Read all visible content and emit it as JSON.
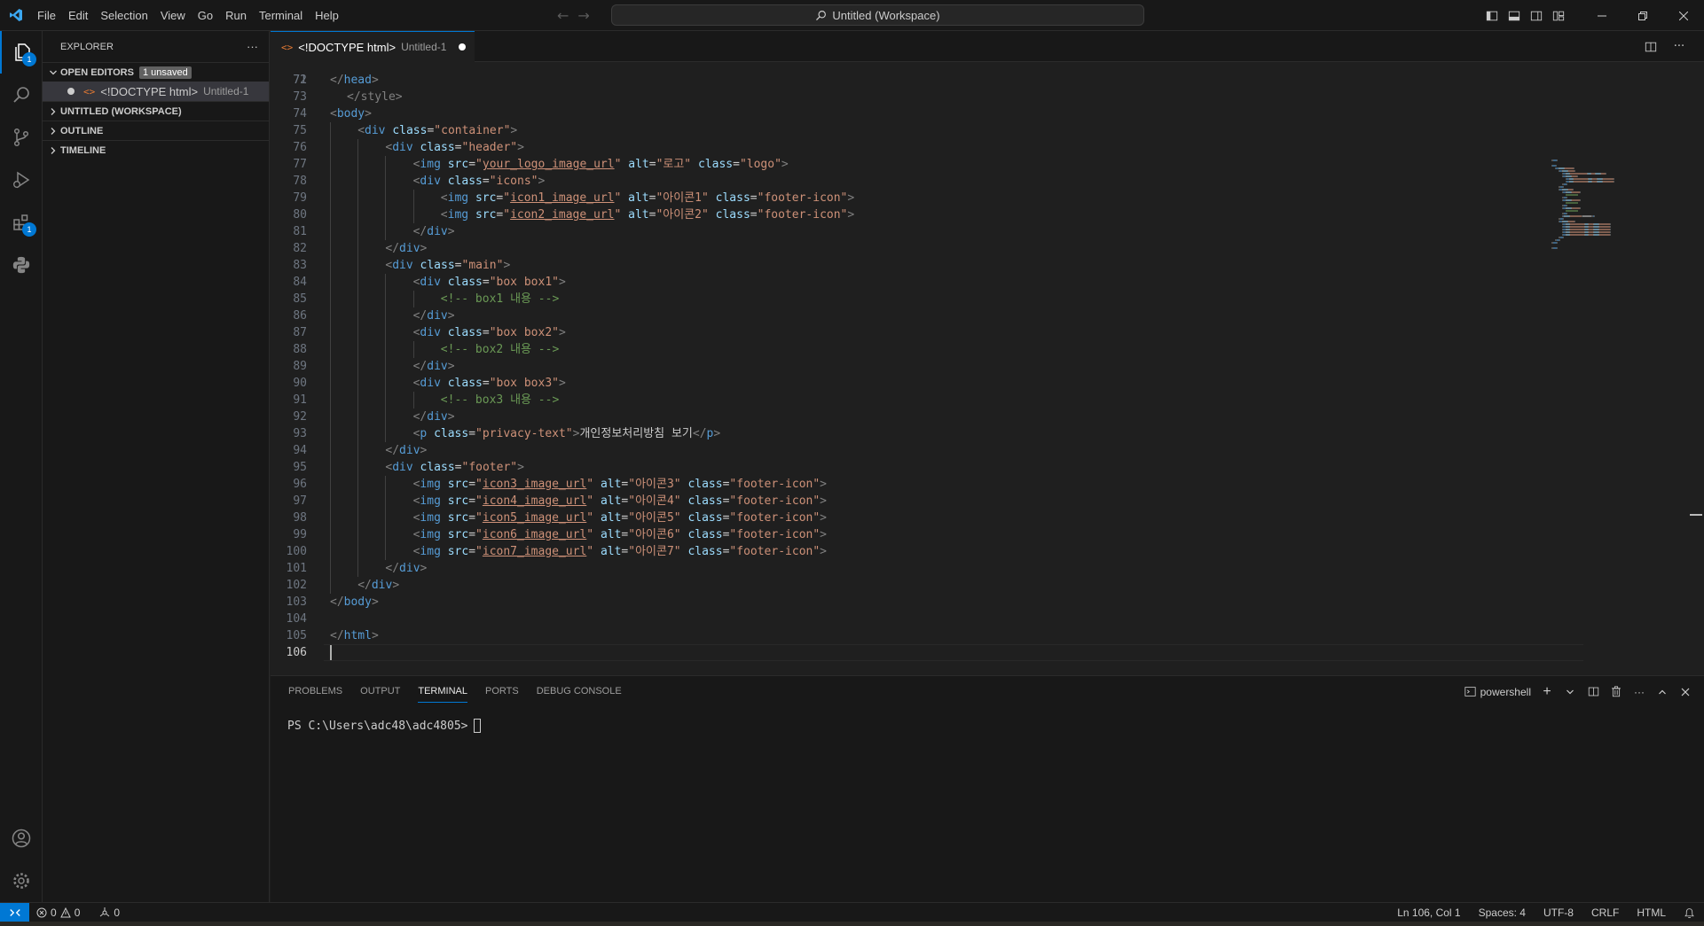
{
  "titlebar": {
    "menu": [
      "File",
      "Edit",
      "Selection",
      "View",
      "Go",
      "Run",
      "Terminal",
      "Help"
    ],
    "search_text": "Untitled (Workspace)"
  },
  "activitybar": {
    "explorer_badge": "1",
    "extensions_badge": "1"
  },
  "sidebar": {
    "title": "EXPLORER",
    "more": "···",
    "open_editors": "OPEN EDITORS",
    "unsaved_badge": "1 unsaved",
    "open_file_name": "<!DOCTYPE html>",
    "open_file_desc": "Untitled-1",
    "sections": [
      "UNTITLED (WORKSPACE)",
      "OUTLINE",
      "TIMELINE"
    ]
  },
  "editor": {
    "tab_name": "<!DOCTYPE html>",
    "tab_desc": "Untitled-1",
    "top_partial": "</style>",
    "lines": [
      {
        "n": "72",
        "indent": 0,
        "parts": [
          [
            "brk",
            "</"
          ],
          [
            "tag",
            "head"
          ],
          [
            "brk",
            ">"
          ]
        ]
      },
      {
        "n": "73",
        "indent": 0,
        "parts": []
      },
      {
        "n": "74",
        "indent": 0,
        "parts": [
          [
            "brk",
            "<"
          ],
          [
            "tag",
            "body"
          ],
          [
            "brk",
            ">"
          ]
        ]
      },
      {
        "n": "75",
        "indent": 1,
        "parts": [
          [
            "brk",
            "<"
          ],
          [
            "tag",
            "div"
          ],
          [
            "txt",
            " "
          ],
          [
            "attr",
            "class"
          ],
          [
            "txt",
            "="
          ],
          [
            "str",
            "\"container\""
          ],
          [
            "brk",
            ">"
          ]
        ]
      },
      {
        "n": "76",
        "indent": 2,
        "parts": [
          [
            "brk",
            "<"
          ],
          [
            "tag",
            "div"
          ],
          [
            "txt",
            " "
          ],
          [
            "attr",
            "class"
          ],
          [
            "txt",
            "="
          ],
          [
            "str",
            "\"header\""
          ],
          [
            "brk",
            ">"
          ]
        ]
      },
      {
        "n": "77",
        "indent": 3,
        "parts": [
          [
            "brk",
            "<"
          ],
          [
            "tag",
            "img"
          ],
          [
            "txt",
            " "
          ],
          [
            "attr",
            "src"
          ],
          [
            "txt",
            "="
          ],
          [
            "str",
            "\""
          ],
          [
            "url",
            "your_logo_image_url"
          ],
          [
            "str",
            "\""
          ],
          [
            "txt",
            " "
          ],
          [
            "attr",
            "alt"
          ],
          [
            "txt",
            "="
          ],
          [
            "str",
            "\"로고\""
          ],
          [
            "txt",
            " "
          ],
          [
            "attr",
            "class"
          ],
          [
            "txt",
            "="
          ],
          [
            "str",
            "\"logo\""
          ],
          [
            "brk",
            ">"
          ]
        ]
      },
      {
        "n": "78",
        "indent": 3,
        "parts": [
          [
            "brk",
            "<"
          ],
          [
            "tag",
            "div"
          ],
          [
            "txt",
            " "
          ],
          [
            "attr",
            "class"
          ],
          [
            "txt",
            "="
          ],
          [
            "str",
            "\"icons\""
          ],
          [
            "brk",
            ">"
          ]
        ]
      },
      {
        "n": "79",
        "indent": 4,
        "parts": [
          [
            "brk",
            "<"
          ],
          [
            "tag",
            "img"
          ],
          [
            "txt",
            " "
          ],
          [
            "attr",
            "src"
          ],
          [
            "txt",
            "="
          ],
          [
            "str",
            "\""
          ],
          [
            "url",
            "icon1_image_url"
          ],
          [
            "str",
            "\""
          ],
          [
            "txt",
            " "
          ],
          [
            "attr",
            "alt"
          ],
          [
            "txt",
            "="
          ],
          [
            "str",
            "\"아이콘1\""
          ],
          [
            "txt",
            " "
          ],
          [
            "attr",
            "class"
          ],
          [
            "txt",
            "="
          ],
          [
            "str",
            "\"footer-icon\""
          ],
          [
            "brk",
            ">"
          ]
        ]
      },
      {
        "n": "80",
        "indent": 4,
        "parts": [
          [
            "brk",
            "<"
          ],
          [
            "tag",
            "img"
          ],
          [
            "txt",
            " "
          ],
          [
            "attr",
            "src"
          ],
          [
            "txt",
            "="
          ],
          [
            "str",
            "\""
          ],
          [
            "url",
            "icon2_image_url"
          ],
          [
            "str",
            "\""
          ],
          [
            "txt",
            " "
          ],
          [
            "attr",
            "alt"
          ],
          [
            "txt",
            "="
          ],
          [
            "str",
            "\"아이콘2\""
          ],
          [
            "txt",
            " "
          ],
          [
            "attr",
            "class"
          ],
          [
            "txt",
            "="
          ],
          [
            "str",
            "\"footer-icon\""
          ],
          [
            "brk",
            ">"
          ]
        ]
      },
      {
        "n": "81",
        "indent": 3,
        "parts": [
          [
            "brk",
            "</"
          ],
          [
            "tag",
            "div"
          ],
          [
            "brk",
            ">"
          ]
        ]
      },
      {
        "n": "82",
        "indent": 2,
        "parts": [
          [
            "brk",
            "</"
          ],
          [
            "tag",
            "div"
          ],
          [
            "brk",
            ">"
          ]
        ]
      },
      {
        "n": "83",
        "indent": 2,
        "parts": [
          [
            "brk",
            "<"
          ],
          [
            "tag",
            "div"
          ],
          [
            "txt",
            " "
          ],
          [
            "attr",
            "class"
          ],
          [
            "txt",
            "="
          ],
          [
            "str",
            "\"main\""
          ],
          [
            "brk",
            ">"
          ]
        ]
      },
      {
        "n": "84",
        "indent": 3,
        "parts": [
          [
            "brk",
            "<"
          ],
          [
            "tag",
            "div"
          ],
          [
            "txt",
            " "
          ],
          [
            "attr",
            "class"
          ],
          [
            "txt",
            "="
          ],
          [
            "str",
            "\"box box1\""
          ],
          [
            "brk",
            ">"
          ]
        ]
      },
      {
        "n": "85",
        "indent": 4,
        "parts": [
          [
            "cmt",
            "<!-- box1 내용 -->"
          ]
        ]
      },
      {
        "n": "86",
        "indent": 3,
        "parts": [
          [
            "brk",
            "</"
          ],
          [
            "tag",
            "div"
          ],
          [
            "brk",
            ">"
          ]
        ]
      },
      {
        "n": "87",
        "indent": 3,
        "parts": [
          [
            "brk",
            "<"
          ],
          [
            "tag",
            "div"
          ],
          [
            "txt",
            " "
          ],
          [
            "attr",
            "class"
          ],
          [
            "txt",
            "="
          ],
          [
            "str",
            "\"box box2\""
          ],
          [
            "brk",
            ">"
          ]
        ]
      },
      {
        "n": "88",
        "indent": 4,
        "parts": [
          [
            "cmt",
            "<!-- box2 내용 -->"
          ]
        ]
      },
      {
        "n": "89",
        "indent": 3,
        "parts": [
          [
            "brk",
            "</"
          ],
          [
            "tag",
            "div"
          ],
          [
            "brk",
            ">"
          ]
        ]
      },
      {
        "n": "90",
        "indent": 3,
        "parts": [
          [
            "brk",
            "<"
          ],
          [
            "tag",
            "div"
          ],
          [
            "txt",
            " "
          ],
          [
            "attr",
            "class"
          ],
          [
            "txt",
            "="
          ],
          [
            "str",
            "\"box box3\""
          ],
          [
            "brk",
            ">"
          ]
        ]
      },
      {
        "n": "91",
        "indent": 4,
        "parts": [
          [
            "cmt",
            "<!-- box3 내용 -->"
          ]
        ]
      },
      {
        "n": "92",
        "indent": 3,
        "parts": [
          [
            "brk",
            "</"
          ],
          [
            "tag",
            "div"
          ],
          [
            "brk",
            ">"
          ]
        ]
      },
      {
        "n": "93",
        "indent": 3,
        "parts": [
          [
            "brk",
            "<"
          ],
          [
            "tag",
            "p"
          ],
          [
            "txt",
            " "
          ],
          [
            "attr",
            "class"
          ],
          [
            "txt",
            "="
          ],
          [
            "str",
            "\"privacy-text\""
          ],
          [
            "brk",
            ">"
          ],
          [
            "txt",
            "개인정보처리방침 보기"
          ],
          [
            "brk",
            "</"
          ],
          [
            "tag",
            "p"
          ],
          [
            "brk",
            ">"
          ]
        ]
      },
      {
        "n": "94",
        "indent": 2,
        "parts": [
          [
            "brk",
            "</"
          ],
          [
            "tag",
            "div"
          ],
          [
            "brk",
            ">"
          ]
        ]
      },
      {
        "n": "95",
        "indent": 2,
        "parts": [
          [
            "brk",
            "<"
          ],
          [
            "tag",
            "div"
          ],
          [
            "txt",
            " "
          ],
          [
            "attr",
            "class"
          ],
          [
            "txt",
            "="
          ],
          [
            "str",
            "\"footer\""
          ],
          [
            "brk",
            ">"
          ]
        ]
      },
      {
        "n": "96",
        "indent": 3,
        "parts": [
          [
            "brk",
            "<"
          ],
          [
            "tag",
            "img"
          ],
          [
            "txt",
            " "
          ],
          [
            "attr",
            "src"
          ],
          [
            "txt",
            "="
          ],
          [
            "str",
            "\""
          ],
          [
            "url",
            "icon3_image_url"
          ],
          [
            "str",
            "\""
          ],
          [
            "txt",
            " "
          ],
          [
            "attr",
            "alt"
          ],
          [
            "txt",
            "="
          ],
          [
            "str",
            "\"아이콘3\""
          ],
          [
            "txt",
            " "
          ],
          [
            "attr",
            "class"
          ],
          [
            "txt",
            "="
          ],
          [
            "str",
            "\"footer-icon\""
          ],
          [
            "brk",
            ">"
          ]
        ]
      },
      {
        "n": "97",
        "indent": 3,
        "parts": [
          [
            "brk",
            "<"
          ],
          [
            "tag",
            "img"
          ],
          [
            "txt",
            " "
          ],
          [
            "attr",
            "src"
          ],
          [
            "txt",
            "="
          ],
          [
            "str",
            "\""
          ],
          [
            "url",
            "icon4_image_url"
          ],
          [
            "str",
            "\""
          ],
          [
            "txt",
            " "
          ],
          [
            "attr",
            "alt"
          ],
          [
            "txt",
            "="
          ],
          [
            "str",
            "\"아이콘4\""
          ],
          [
            "txt",
            " "
          ],
          [
            "attr",
            "class"
          ],
          [
            "txt",
            "="
          ],
          [
            "str",
            "\"footer-icon\""
          ],
          [
            "brk",
            ">"
          ]
        ]
      },
      {
        "n": "98",
        "indent": 3,
        "parts": [
          [
            "brk",
            "<"
          ],
          [
            "tag",
            "img"
          ],
          [
            "txt",
            " "
          ],
          [
            "attr",
            "src"
          ],
          [
            "txt",
            "="
          ],
          [
            "str",
            "\""
          ],
          [
            "url",
            "icon5_image_url"
          ],
          [
            "str",
            "\""
          ],
          [
            "txt",
            " "
          ],
          [
            "attr",
            "alt"
          ],
          [
            "txt",
            "="
          ],
          [
            "str",
            "\"아이콘5\""
          ],
          [
            "txt",
            " "
          ],
          [
            "attr",
            "class"
          ],
          [
            "txt",
            "="
          ],
          [
            "str",
            "\"footer-icon\""
          ],
          [
            "brk",
            ">"
          ]
        ]
      },
      {
        "n": "99",
        "indent": 3,
        "parts": [
          [
            "brk",
            "<"
          ],
          [
            "tag",
            "img"
          ],
          [
            "txt",
            " "
          ],
          [
            "attr",
            "src"
          ],
          [
            "txt",
            "="
          ],
          [
            "str",
            "\""
          ],
          [
            "url",
            "icon6_image_url"
          ],
          [
            "str",
            "\""
          ],
          [
            "txt",
            " "
          ],
          [
            "attr",
            "alt"
          ],
          [
            "txt",
            "="
          ],
          [
            "str",
            "\"아이콘6\""
          ],
          [
            "txt",
            " "
          ],
          [
            "attr",
            "class"
          ],
          [
            "txt",
            "="
          ],
          [
            "str",
            "\"footer-icon\""
          ],
          [
            "brk",
            ">"
          ]
        ]
      },
      {
        "n": "100",
        "indent": 3,
        "parts": [
          [
            "brk",
            "<"
          ],
          [
            "tag",
            "img"
          ],
          [
            "txt",
            " "
          ],
          [
            "attr",
            "src"
          ],
          [
            "txt",
            "="
          ],
          [
            "str",
            "\""
          ],
          [
            "url",
            "icon7_image_url"
          ],
          [
            "str",
            "\""
          ],
          [
            "txt",
            " "
          ],
          [
            "attr",
            "alt"
          ],
          [
            "txt",
            "="
          ],
          [
            "str",
            "\"아이콘7\""
          ],
          [
            "txt",
            " "
          ],
          [
            "attr",
            "class"
          ],
          [
            "txt",
            "="
          ],
          [
            "str",
            "\"footer-icon\""
          ],
          [
            "brk",
            ">"
          ]
        ]
      },
      {
        "n": "101",
        "indent": 2,
        "parts": [
          [
            "brk",
            "</"
          ],
          [
            "tag",
            "div"
          ],
          [
            "brk",
            ">"
          ]
        ]
      },
      {
        "n": "102",
        "indent": 1,
        "parts": [
          [
            "brk",
            "</"
          ],
          [
            "tag",
            "div"
          ],
          [
            "brk",
            ">"
          ]
        ]
      },
      {
        "n": "103",
        "indent": 0,
        "parts": [
          [
            "brk",
            "</"
          ],
          [
            "tag",
            "body"
          ],
          [
            "brk",
            ">"
          ]
        ]
      },
      {
        "n": "104",
        "indent": 0,
        "parts": []
      },
      {
        "n": "105",
        "indent": 0,
        "parts": [
          [
            "brk",
            "</"
          ],
          [
            "tag",
            "html"
          ],
          [
            "brk",
            ">"
          ]
        ]
      },
      {
        "n": "106",
        "indent": 0,
        "parts": [],
        "current": true
      }
    ]
  },
  "panel": {
    "tabs": [
      "PROBLEMS",
      "OUTPUT",
      "TERMINAL",
      "PORTS",
      "DEBUG CONSOLE"
    ],
    "active_tab": "TERMINAL",
    "shell": "powershell",
    "prompt": "PS C:\\Users\\adc48\\adc4805>"
  },
  "statusbar": {
    "errors": "0",
    "warnings": "0",
    "ports": "0",
    "position": "Ln 106, Col 1",
    "spaces": "Spaces: 4",
    "encoding": "UTF-8",
    "eol": "CRLF",
    "language": "HTML"
  },
  "colors": {
    "accent": "#0078d4",
    "tag": "#569cd6",
    "attr": "#9cdcfe",
    "string": "#ce9178",
    "comment": "#6a9955"
  }
}
